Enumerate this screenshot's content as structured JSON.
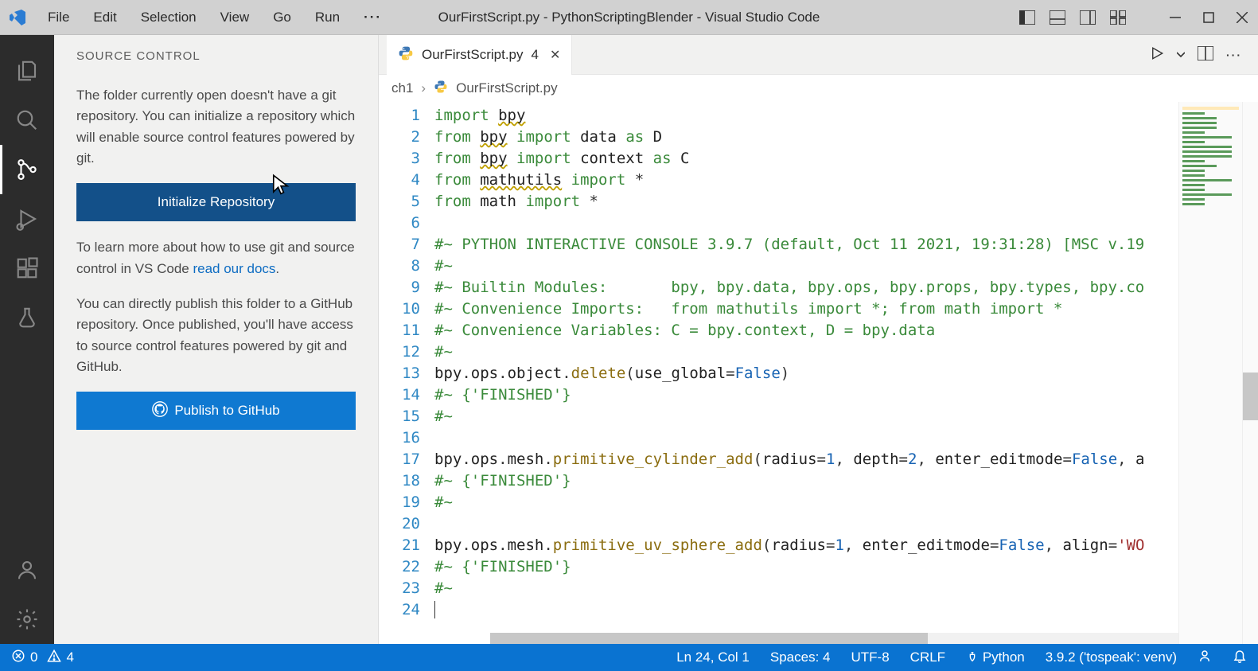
{
  "title": "OurFirstScript.py - PythonScriptingBlender - Visual Studio Code",
  "menu": {
    "file": "File",
    "edit": "Edit",
    "selection": "Selection",
    "view": "View",
    "go": "Go",
    "run": "Run",
    "more": "···"
  },
  "sidebar": {
    "title": "SOURCE CONTROL",
    "p1": "The folder currently open doesn't have a git repository. You can initialize a repository which will enable source control features powered by git.",
    "btn_init": "Initialize Repository",
    "p2a": "To learn more about how to use git and source control in VS Code ",
    "p2link": "read our docs",
    "p2b": ".",
    "p3": "You can directly publish this folder to a GitHub repository. Once published, you'll have access to source control features powered by git and GitHub.",
    "btn_pub": "Publish to GitHub"
  },
  "tab": {
    "name": "OurFirstScript.py",
    "modified": "4"
  },
  "breadcrumb": {
    "seg1": "ch1",
    "seg2": "OurFirstScript.py"
  },
  "code_lines": 24,
  "status": {
    "errors": "0",
    "warnings": "4",
    "lncol": "Ln 24, Col 1",
    "spaces": "Spaces: 4",
    "enc": "UTF-8",
    "eol": "CRLF",
    "lang": "Python",
    "interp": "3.9.2 ('tospeak': venv)"
  }
}
